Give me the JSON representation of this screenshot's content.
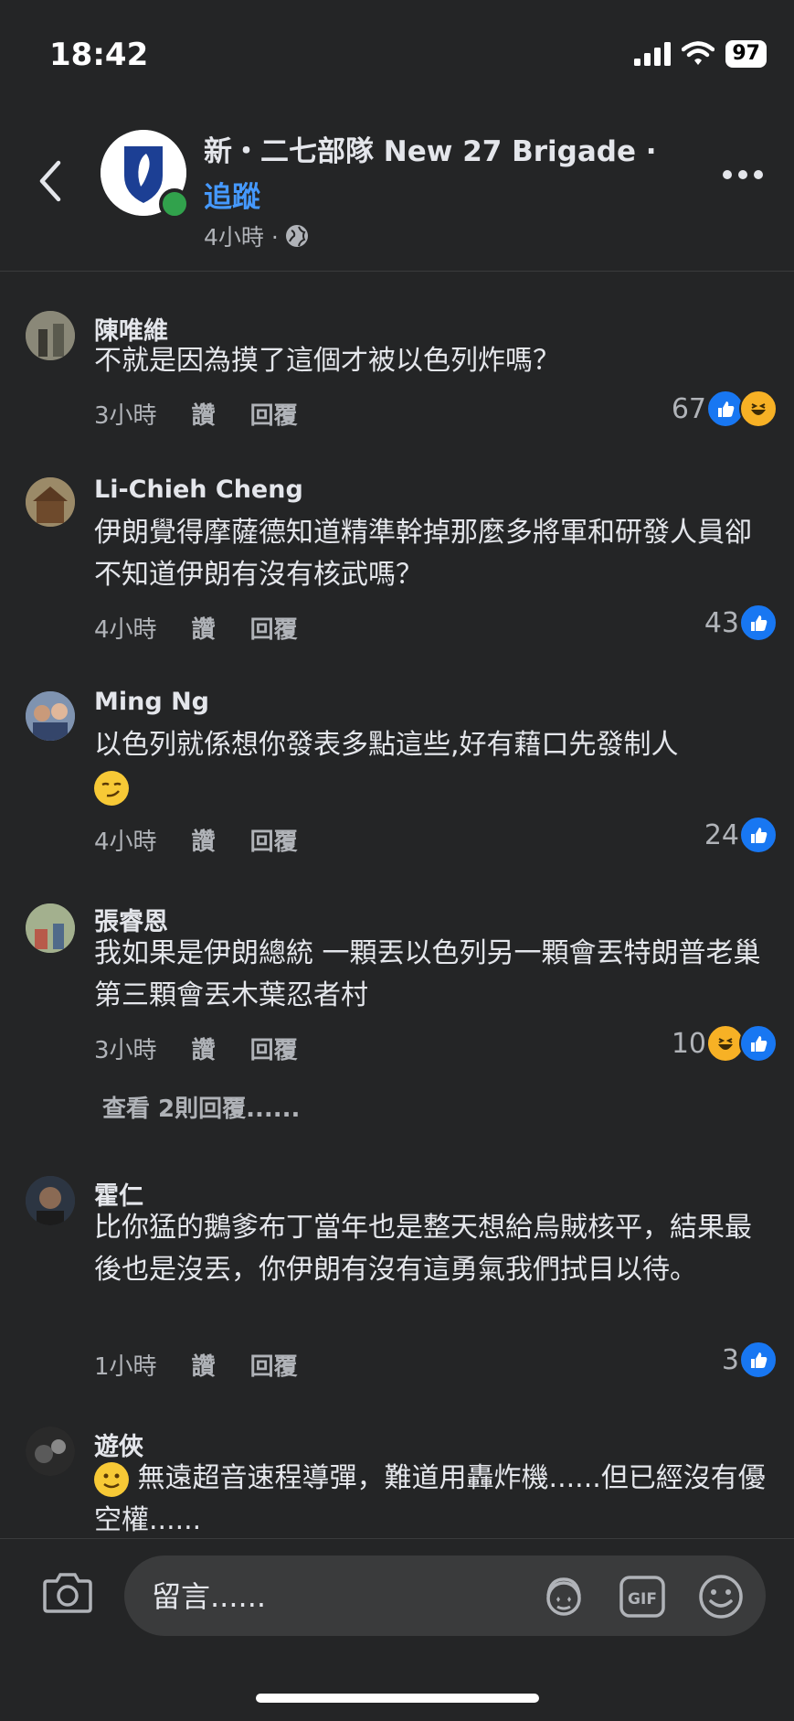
{
  "status_bar": {
    "time": "18:42",
    "battery": "97"
  },
  "header": {
    "page_name": "新・二七部隊 New 27 Brigade ·",
    "follow_label": "追蹤",
    "post_time": "4小時 ·",
    "icons": [
      "back-icon",
      "globe-icon",
      "more-icon"
    ]
  },
  "comments": [
    {
      "author": "陳唯維",
      "text": "不就是因為摸了這個才被以色列炸嗎？",
      "time": "3小時",
      "like": "讚",
      "reply": "回覆",
      "count": "67",
      "reactions": [
        "like",
        "haha"
      ]
    },
    {
      "author": "Li-Chieh Cheng",
      "text": "伊朗覺得摩薩德知道精準幹掉那麼多將軍和研發人員卻不知道伊朗有沒有核武嗎？",
      "time": "4小時",
      "like": "讚",
      "reply": "回覆",
      "count": "43",
      "reactions": [
        "like"
      ]
    },
    {
      "author": "Ming Ng",
      "text": "以色列就係想你發表多點這些,好有藉口先發制人",
      "time": "4小時",
      "like": "讚",
      "reply": "回覆",
      "count": "24",
      "reactions": [
        "like"
      ]
    },
    {
      "author": "張睿恩",
      "text": "我如果是伊朗總統 一顆丟以色列另一顆會丟特朗普老巢 第三顆會丟木葉忍者村",
      "time": "3小時",
      "like": "讚",
      "reply": "回覆",
      "count": "10",
      "reactions": [
        "haha",
        "like"
      ],
      "view_replies": "查看 2則回覆......"
    },
    {
      "author": "霍仁",
      "text": "比你猛的鵝爹布丁當年也是整天想給烏賊核平，結果最後也是沒丟，你伊朗有沒有這勇氣我們拭目以待。",
      "time": "1小時",
      "like": "讚",
      "reply": "回覆",
      "count": "3",
      "reactions": [
        "like"
      ]
    },
    {
      "author": "遊俠",
      "text": "無遠超音速程導彈，難道用轟炸機......但已經沒有優空權......"
    }
  ],
  "composer": {
    "placeholder": "留言......",
    "icons": [
      "camera-icon",
      "avatar-sticker-icon",
      "gif-icon",
      "emoji-icon"
    ]
  },
  "colors": {
    "background": "#242526",
    "accent": "#4599ff",
    "like": "#1877f2",
    "online": "#31a24c"
  }
}
